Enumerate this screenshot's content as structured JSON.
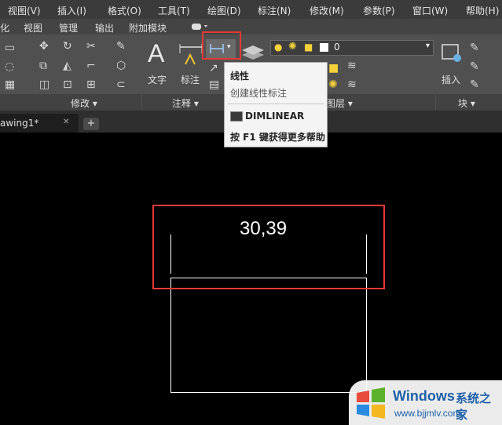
{
  "menubar": {
    "items": [
      "视图(V)",
      "插入(I)",
      "格式(O)",
      "工具(T)",
      "绘图(D)",
      "标注(N)",
      "修改(M)",
      "参数(P)",
      "窗口(W)",
      "帮助(H)"
    ]
  },
  "ribbon_tabs": [
    "化",
    "视图",
    "管理",
    "输出",
    "附加模块"
  ],
  "ribbon": {
    "panels": [
      "修改 ▾",
      "注释 ▾",
      "图层 ▾",
      "块 ▾"
    ],
    "buttons": {
      "text_label": "文字",
      "dimension_label": "标注",
      "insert_label": "插入"
    },
    "layer_value": "0"
  },
  "tooltip": {
    "title": "线性",
    "description": "创建线性标注",
    "command": "DIMLINEAR",
    "help": "按 F1 键获得更多帮助"
  },
  "document_tab": {
    "name": "awing1*",
    "close": "✕",
    "add": "+"
  },
  "canvas": {
    "dimension_text": "30,39"
  },
  "watermark": {
    "brand": "Windows",
    "suffix": "系统之家",
    "url": "www.bjjmlv.com"
  },
  "colors": {
    "highlight": "#e53935",
    "ribbon_bg": "#505050",
    "canvas_bg": "#000000"
  }
}
